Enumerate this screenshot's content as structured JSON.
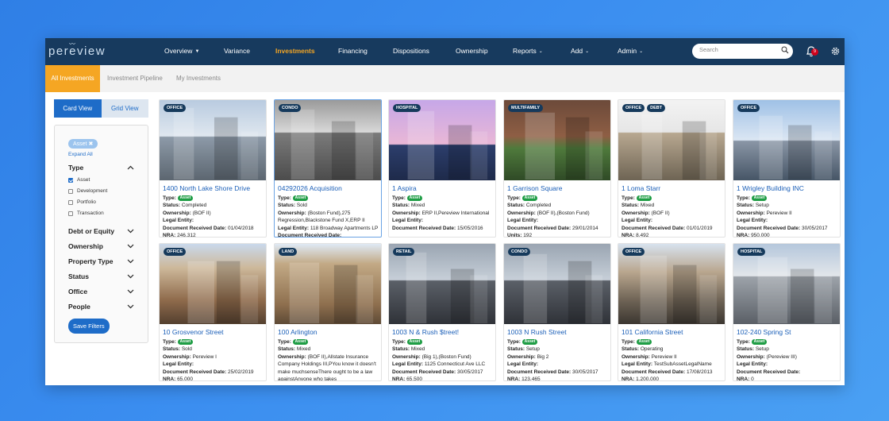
{
  "app": {
    "logo": "pereview"
  },
  "nav": {
    "items": [
      {
        "label": "Overview",
        "caret": true
      },
      {
        "label": "Variance",
        "caret": false
      },
      {
        "label": "Investments",
        "caret": false,
        "active": true
      },
      {
        "label": "Financing",
        "caret": false
      },
      {
        "label": "Dispositions",
        "caret": false
      },
      {
        "label": "Ownership",
        "caret": false
      },
      {
        "label": "Reports",
        "caret": true
      },
      {
        "label": "Add",
        "caret": true
      },
      {
        "label": "Admin",
        "caret": true
      }
    ],
    "search_placeholder": "Search",
    "notification_count": "9",
    "icons": {
      "search": "search-icon",
      "bell": "bell-icon",
      "settings": "gear-icon"
    }
  },
  "subnav": {
    "tabs": [
      "All Investments",
      "Investment Pipeline",
      "My Investments"
    ]
  },
  "sidebar": {
    "view_card": "Card View",
    "view_grid": "Grid View",
    "active_chip": "Asset",
    "expand_all": "Expand All",
    "type_header": "Type",
    "type_options": [
      {
        "label": "Asset",
        "checked": true
      },
      {
        "label": "Development",
        "checked": false
      },
      {
        "label": "Portfolio",
        "checked": false
      },
      {
        "label": "Transaction",
        "checked": false
      }
    ],
    "groups": [
      "Debt or Equity",
      "Ownership",
      "Property Type",
      "Status",
      "Office",
      "People"
    ],
    "save_label": "Save Filters"
  },
  "labels": {
    "type": "Type:",
    "status": "Status:",
    "ownership": "Ownership:",
    "legal": "Legal Entity:",
    "doc_date": "Document Received Date:",
    "nra": "NRA:",
    "units": "Units:",
    "asset_pill": "Asset"
  },
  "cards": [
    {
      "tags": [
        "OFFICE"
      ],
      "title": "1400 North Lake Shore Drive",
      "status": "Completed",
      "ownership": "(BOF II)",
      "legal": "",
      "doc_date": "01/04/2018",
      "extra_label": "NRA:",
      "extra": "246,312"
    },
    {
      "tags": [
        "CONDO"
      ],
      "title": "04292026 Acquisition",
      "status": "Sold",
      "ownership": "(Boston Fund),275 Regression,Blackstone Fund X,ERP II",
      "legal": "118 Broadway Apartments LP",
      "doc_date": "",
      "extra_label": "",
      "extra": ""
    },
    {
      "tags": [
        "HOSPITAL"
      ],
      "title": "1 Aspira",
      "status": "Mixed",
      "ownership": "ERP II,Pereview International",
      "legal": "",
      "doc_date": "15/05/2016",
      "extra_label": "",
      "extra": ""
    },
    {
      "tags": [
        "MULTIFAMILY"
      ],
      "title": "1 Garrison Square",
      "status": "Completed",
      "ownership": "(BOF II),(Boston Fund)",
      "legal": "",
      "doc_date": "29/01/2014",
      "extra_label": "Units:",
      "extra": "192"
    },
    {
      "tags": [
        "OFFICE",
        "DEBT"
      ],
      "title": "1 Loma Starr",
      "status": "Mixed",
      "ownership": "(BOF II)",
      "legal": "",
      "doc_date": "01/01/2019",
      "extra_label": "NRA:",
      "extra": "8,492"
    },
    {
      "tags": [
        "OFFICE"
      ],
      "title": "1 Wrigley Building INC",
      "status": "Setup",
      "ownership": "Pereview II",
      "legal": "",
      "doc_date": "30/05/2017",
      "extra_label": "NRA:",
      "extra": "950,000"
    },
    {
      "tags": [
        "OFFICE"
      ],
      "title": "10 Grosvenor Street",
      "status": "Sold",
      "ownership": "Pereview I",
      "legal": "",
      "doc_date": "25/02/2019",
      "extra_label": "NRA:",
      "extra": "65,000"
    },
    {
      "tags": [
        "LAND"
      ],
      "title": "100 Arlington",
      "status": "Mixed",
      "ownership": "(BOF II),Allstate Insurance Company Holdings III,PYou know it doesn't make muchsenseThere ought to be a law againstAnyone who takes",
      "legal": "",
      "doc_date": "",
      "extra_label": "",
      "extra": ""
    },
    {
      "tags": [
        "RETAIL"
      ],
      "title": "1003 N & Rush $treet!",
      "status": "Mixed",
      "ownership": "(Big 1),(Boston Fund)",
      "legal": "1125 Connecticut Ave LLC",
      "doc_date": "30/05/2017",
      "extra_label": "NRA:",
      "extra": "65,500"
    },
    {
      "tags": [
        "CONDO"
      ],
      "title": "1003 N Rush Street",
      "status": "Setup",
      "ownership": "Big 2",
      "legal": "",
      "doc_date": "30/05/2017",
      "extra_label": "NRA:",
      "extra": "123,465"
    },
    {
      "tags": [
        "OFFICE"
      ],
      "title": "101 California Street",
      "status": "Operating",
      "ownership": "Pereview II",
      "legal": "TestSubAssetLegalName",
      "doc_date": "17/08/2013",
      "extra_label": "NRA:",
      "extra": "1,200,000"
    },
    {
      "tags": [
        "HOSPITAL"
      ],
      "title": "102-240 Spring St",
      "status": "Setup",
      "ownership": "(Pereview III)",
      "legal": "",
      "doc_date": "",
      "extra_label": "NRA:",
      "extra": "0"
    }
  ],
  "colors": {
    "nav_bg": "#173a5e",
    "accent": "#f5a623",
    "link": "#1b5fb8",
    "primary": "#1e6cc8",
    "badge": "#1f9d45"
  }
}
